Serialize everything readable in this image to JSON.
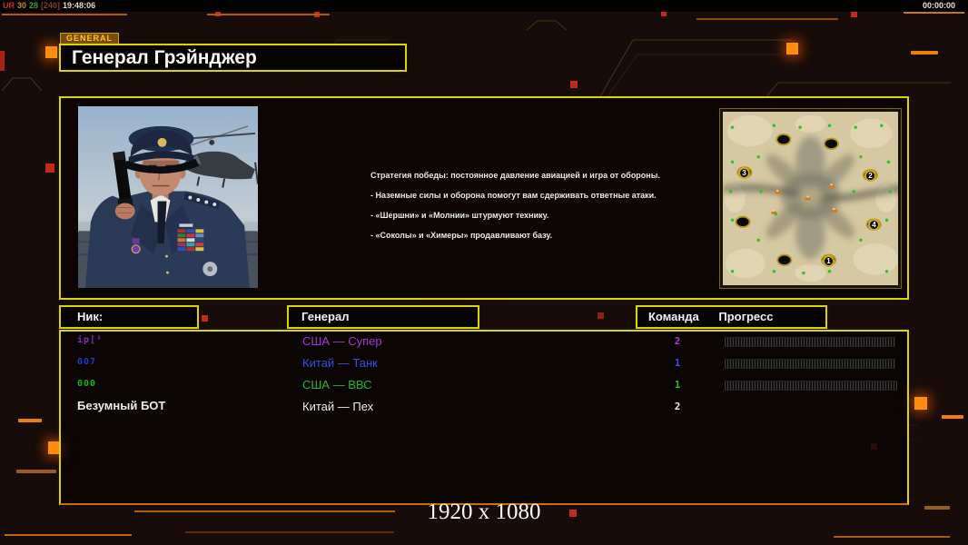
{
  "status_bar": {
    "segments": [
      {
        "text": "UR",
        "color": "#c03228"
      },
      {
        "text": "30",
        "color": "#cc8828"
      },
      {
        "text": "28",
        "color": "#38a038"
      },
      {
        "text": "[240]",
        "color": "#8a4030"
      },
      {
        "text": "19:48:06",
        "color": "#e0d8d0"
      }
    ],
    "timer": "00:00:00"
  },
  "header": {
    "tag": "GENERAL",
    "title": "Генерал Грэйнджер"
  },
  "briefing": {
    "lines": [
      "Стратегия победы: постоянное давление авиацией и игра от обороны.",
      "- Наземные силы и оборона помогут вам сдерживать ответные атаки.",
      "- «Шершни» и «Молнии» штурмуют технику.",
      "- «Соколы» и «Химеры» продавливают базу."
    ]
  },
  "minimap": {
    "start_positions": [
      {
        "label": "1"
      },
      {
        "label": "2"
      },
      {
        "label": "3"
      },
      {
        "label": "4"
      }
    ]
  },
  "table": {
    "headers": {
      "nick": "Ник:",
      "general": "Генерал",
      "team": "Команда",
      "progress": "Прогресс"
    },
    "rows": [
      {
        "name": "ip[¹",
        "general": "США — Супер",
        "team": "2",
        "color": "#a438e0",
        "name_color": "#7b2fc0",
        "has_progress": true
      },
      {
        "name": "007",
        "general": "Китай — Танк",
        "team": "1",
        "color": "#3a50e0",
        "name_color": "#2438d8",
        "has_progress": true
      },
      {
        "name": "000",
        "general": "США — ВВС",
        "team": "1",
        "color": "#2cb82c",
        "name_color": "#20b020",
        "has_progress": true
      },
      {
        "name": "Безумный БОТ",
        "general": "Китай — Пех",
        "team": "2",
        "color": "#ececec",
        "name_color": "#ececec",
        "has_progress": false
      }
    ]
  },
  "footer": {
    "resolution": "1920 x 1080"
  },
  "theme": {
    "accent_yellow": "#d8d800",
    "accent_orange": "#e8820a",
    "alert_red": "#c22a1e",
    "background": "#170c09"
  }
}
